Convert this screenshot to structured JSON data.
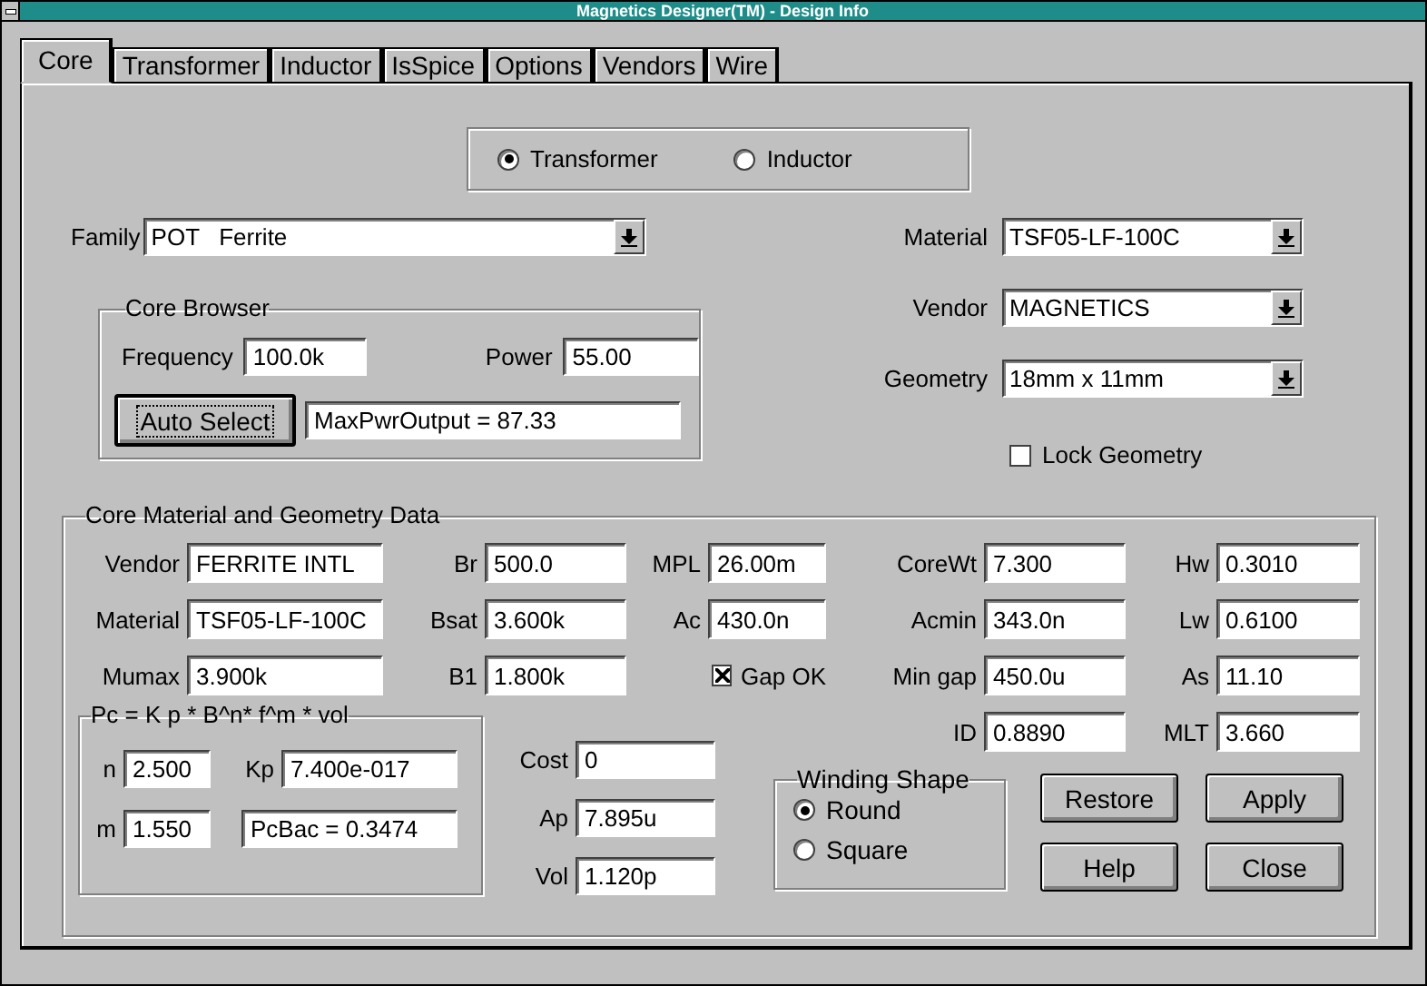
{
  "window": {
    "title": "Magnetics Designer(TM) - Design Info"
  },
  "tabs": [
    {
      "label": "Core",
      "selected": true
    },
    {
      "label": "Transformer",
      "selected": false
    },
    {
      "label": "Inductor",
      "selected": false
    },
    {
      "label": "IsSpice",
      "selected": false
    },
    {
      "label": "Options",
      "selected": false
    },
    {
      "label": "Vendors",
      "selected": false
    },
    {
      "label": "Wire",
      "selected": false
    }
  ],
  "design_type": [
    {
      "label": "Transformer",
      "selected": true
    },
    {
      "label": "Inductor",
      "selected": false
    }
  ],
  "family": {
    "label": "Family",
    "value": "POT   Ferrite"
  },
  "core_browser": {
    "title": "Core Browser",
    "frequency": {
      "label": "Frequency",
      "value": "100.0k"
    },
    "power": {
      "label": "Power",
      "value": "55.00"
    },
    "button": "Auto Select",
    "result": "MaxPwrOutput = 87.33"
  },
  "selectors": [
    {
      "label": "Material",
      "value": "TSF05-LF-100C"
    },
    {
      "label": "Vendor",
      "value": "MAGNETICS"
    },
    {
      "label": "Geometry",
      "value": "18mm x 11mm"
    }
  ],
  "lock_geometry": {
    "label": "Lock Geometry",
    "checked": false
  },
  "core_data": {
    "title": "Core Material and Geometry Data",
    "rows": [
      [
        {
          "label": "Vendor",
          "value": "FERRITE INTL"
        },
        {
          "label": "Br",
          "value": "500.0"
        },
        {
          "label": "MPL",
          "value": "26.00m"
        }
      ],
      [
        {
          "label": "Material",
          "value": "TSF05-LF-100C"
        },
        {
          "label": "Bsat",
          "value": "3.600k"
        },
        {
          "label": "Ac",
          "value": "430.0n"
        }
      ],
      [
        {
          "label": "Mumax",
          "value": "3.900k"
        },
        {
          "label": "B1",
          "value": "1.800k"
        }
      ]
    ],
    "gap_ok": {
      "label": "Gap OK",
      "checked": true
    },
    "loss": {
      "title": "Pc = K p * B^n* f^m * vol",
      "n": {
        "label": "n",
        "value": "2.500"
      },
      "kp": {
        "label": "Kp",
        "value": "7.400e-017"
      },
      "m": {
        "label": "m",
        "value": "1.550"
      },
      "result": "PcBac = 0.3474"
    },
    "extra": [
      {
        "label": "Cost",
        "value": "0"
      },
      {
        "label": "Ap",
        "value": "7.895u"
      },
      {
        "label": "Vol",
        "value": "1.120p"
      }
    ],
    "geometry_rows": [
      [
        {
          "label": "CoreWt",
          "value": "7.300"
        },
        {
          "label": "Hw",
          "value": "0.3010"
        }
      ],
      [
        {
          "label": "Acmin",
          "value": "343.0n"
        },
        {
          "label": "Lw",
          "value": "0.6100"
        }
      ],
      [
        {
          "label": "Min gap",
          "value": "450.0u"
        },
        {
          "label": "As",
          "value": "11.10"
        }
      ],
      [
        {
          "label": "ID",
          "value": "0.8890"
        },
        {
          "label": "MLT",
          "value": "3.660"
        }
      ]
    ],
    "winding_shape": {
      "title": "Winding Shape",
      "options": [
        {
          "label": "Round",
          "selected": true
        },
        {
          "label": "Square",
          "selected": false
        }
      ]
    },
    "buttons": [
      "Restore",
      "Apply",
      "Help",
      "Close"
    ]
  }
}
